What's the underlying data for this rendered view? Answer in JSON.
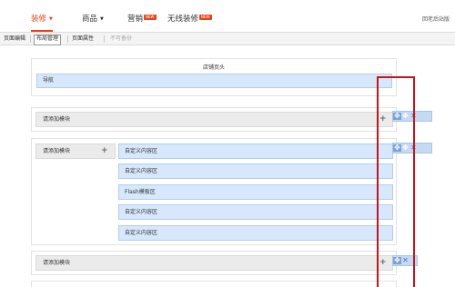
{
  "top_nav": {
    "items": [
      {
        "label": "装修",
        "caret": "▼"
      },
      {
        "label": "商品",
        "caret": "▼"
      },
      {
        "label": "营销",
        "badge": "NEW"
      },
      {
        "label": "无线装修",
        "badge": "NEW"
      }
    ],
    "right_link": "回老后站版"
  },
  "sub_tabs": [
    {
      "label": "页面编辑"
    },
    {
      "label": "布局管理"
    },
    {
      "label": "页面属性"
    },
    {
      "label": "不可备份"
    }
  ],
  "header_section": {
    "title": "店铺页头",
    "nav_module": "导航"
  },
  "add_module_label": "请添加模块",
  "content_modules": [
    "自定义内容区",
    "自定义内容区",
    "Flash模板区",
    "自定义内容区",
    "自定义内容区"
  ],
  "icons": {
    "add": "plus-icon",
    "move": "move-icon",
    "delete": "close-icon"
  },
  "colors": {
    "accent": "#e8431b",
    "module_bg": "#d8e8fc",
    "highlight_box": "#c0161c"
  }
}
